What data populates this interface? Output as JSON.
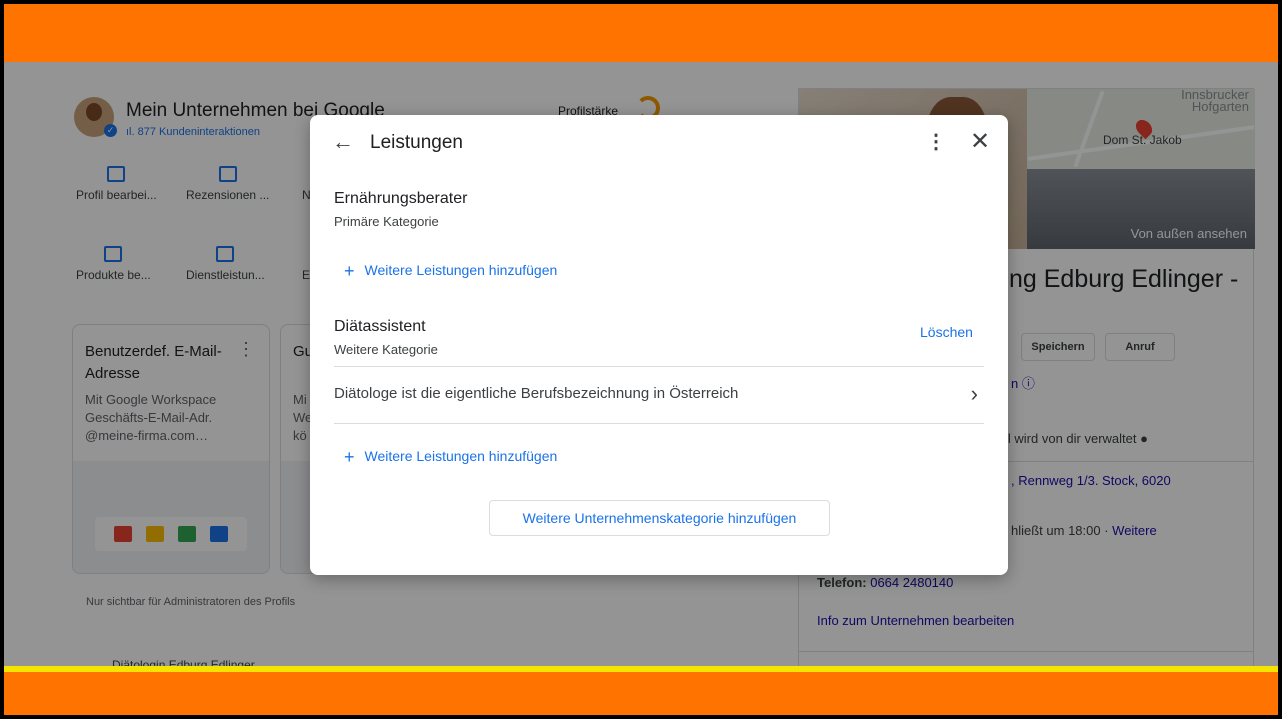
{
  "background": {
    "business_title": "Mein Unternehmen bei Google",
    "interactions": "877 Kundeninteraktionen",
    "profile_strength": "Profilstärke",
    "actions": [
      {
        "label": "Profil bearbei..."
      },
      {
        "label": "Rezensionen ..."
      },
      {
        "label": "N"
      },
      {
        "label": "Produkte be..."
      },
      {
        "label": "Dienstleistun..."
      },
      {
        "label": "E"
      }
    ],
    "card1": {
      "title": "Benutzerdef. E-Mail-Adresse",
      "line1": "Mit Google Workspace",
      "line2": "Geschäfts-E-Mail-Adr.",
      "line3": "@meine-firma.com…"
    },
    "card2": {
      "title": "Gu",
      "line1": "Mi",
      "line2": "We",
      "line3": "kö"
    },
    "admin_note": "Nur sichtbar für Administratoren des Profils",
    "bottom_name": "Diätologin Edburg Edlinger",
    "right": {
      "map_label_line1": "Innsbrucker",
      "map_label_line2": "Hofgarten",
      "map_place": "Dom St. Jakob",
      "street_view": "Von außen ansehen",
      "name_partial": "ng Edburg Edlinger -",
      "btn_save": "Speichern",
      "btn_call": "Anruf",
      "partial_n": "n",
      "managed": "il wird von dir verwaltet",
      "address": ", Rennweg 1/3. Stock, 6020",
      "hours_prefix": "hließt um 18:00 · ",
      "hours_more": "Weitere",
      "phone_label": "Telefon:",
      "phone": "0664 2480140",
      "edit_info": "Info zum Unternehmen bearbeiten"
    }
  },
  "modal": {
    "title": "Leistungen",
    "primary": {
      "name": "Ernährungsberater",
      "type": "Primäre Kategorie"
    },
    "add_services": "Weitere Leistungen hinzufügen",
    "secondary": {
      "name": "Diätassistent",
      "type": "Weitere Kategorie"
    },
    "delete": "Löschen",
    "service": "Diätologe ist die eigentliche Berufsbezeichnung in Österreich",
    "add_services_2": "Weitere Leistungen hinzufügen",
    "add_category": "Weitere Unternehmenskategorie hinzufügen"
  },
  "colors": {
    "accent": "#1a73e8",
    "frame": "#ff7400",
    "stripe": "#f5e400"
  }
}
